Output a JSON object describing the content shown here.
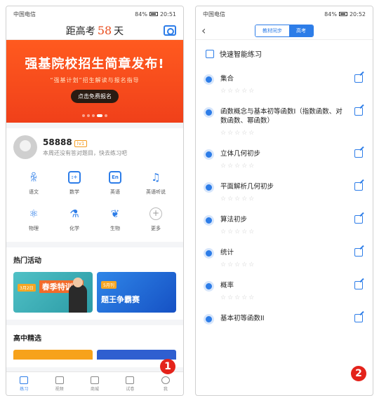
{
  "left": {
    "status": {
      "carrier": "中国电信",
      "battery": "84%",
      "time": "20:51"
    },
    "header": {
      "prefix": "距高考",
      "days": "58",
      "suffix": "天"
    },
    "banner": {
      "title": "强基院校招生简章发布!",
      "subtitle": "“强基计划”招生解读与报名指导",
      "button": "点击免费报名"
    },
    "profile": {
      "username": "58888",
      "level": "lv1",
      "tip": "本周还没有答对题目，快去练习吧"
    },
    "subjects": [
      {
        "label": "语文",
        "icon": "chinese-icon"
      },
      {
        "label": "数学",
        "icon": "math-icon"
      },
      {
        "label": "英语",
        "icon": "english-icon"
      },
      {
        "label": "英语听说",
        "icon": "headphones-icon"
      },
      {
        "label": "物理",
        "icon": "atom-icon"
      },
      {
        "label": "化学",
        "icon": "flask-icon"
      },
      {
        "label": "生物",
        "icon": "leaf-icon"
      },
      {
        "label": "更多",
        "icon": "plus-icon"
      }
    ],
    "hot": {
      "title": "热门活动",
      "cards": [
        {
          "badge": "3月2日",
          "title": "春季特训班"
        },
        {
          "badge": "5月刊",
          "title": "题王争霸赛"
        }
      ]
    },
    "selection": {
      "title": "高中精选"
    },
    "tabs": [
      {
        "label": "练习",
        "active": true
      },
      {
        "label": "视频"
      },
      {
        "label": "商城"
      },
      {
        "label": "试卷"
      },
      {
        "label": "我"
      }
    ],
    "marker": "1"
  },
  "right": {
    "status": {
      "carrier": "中国电信",
      "battery": "84%",
      "time": "20:52"
    },
    "header": {
      "back": "‹",
      "seg": [
        "教材同步",
        "高考"
      ]
    },
    "quick": "快速智能练习",
    "stars": "☆☆☆☆☆",
    "topics": [
      "集合",
      "函数概念与基本初等函数I（指数函数、对数函数、幂函数）",
      "立体几何初步",
      "平面解析几何初步",
      "算法初步",
      "统计",
      "概率",
      "基本初等函数II"
    ],
    "marker": "2"
  },
  "colors": {
    "accent": "#2d7de8",
    "banner": "#f0401a",
    "marker": "#e4231b"
  }
}
